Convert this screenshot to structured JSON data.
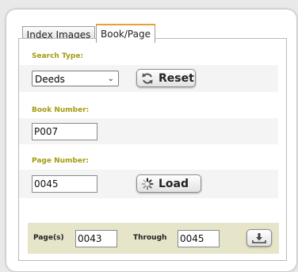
{
  "tabs": [
    {
      "label": "Index Images",
      "active": false
    },
    {
      "label": "Book/Page",
      "active": true
    }
  ],
  "search_type": {
    "label": "Search Type:",
    "value": "Deeds"
  },
  "reset_button": {
    "label": "Reset",
    "icon": "refresh-icon"
  },
  "book_number": {
    "label": "Book Number:",
    "value": "P007"
  },
  "page_number": {
    "label": "Page Number:",
    "value": "0045"
  },
  "load_button": {
    "label": "Load",
    "icon": "spinner-icon"
  },
  "page_range": {
    "pages_label": "Page(s)",
    "from_value": "0043",
    "through_label": "Through",
    "to_value": "0045",
    "download_icon": "download-icon"
  },
  "colors": {
    "accent": "#e5a52c",
    "label": "#a59b10",
    "footer_bg": "#e6e4c9"
  }
}
